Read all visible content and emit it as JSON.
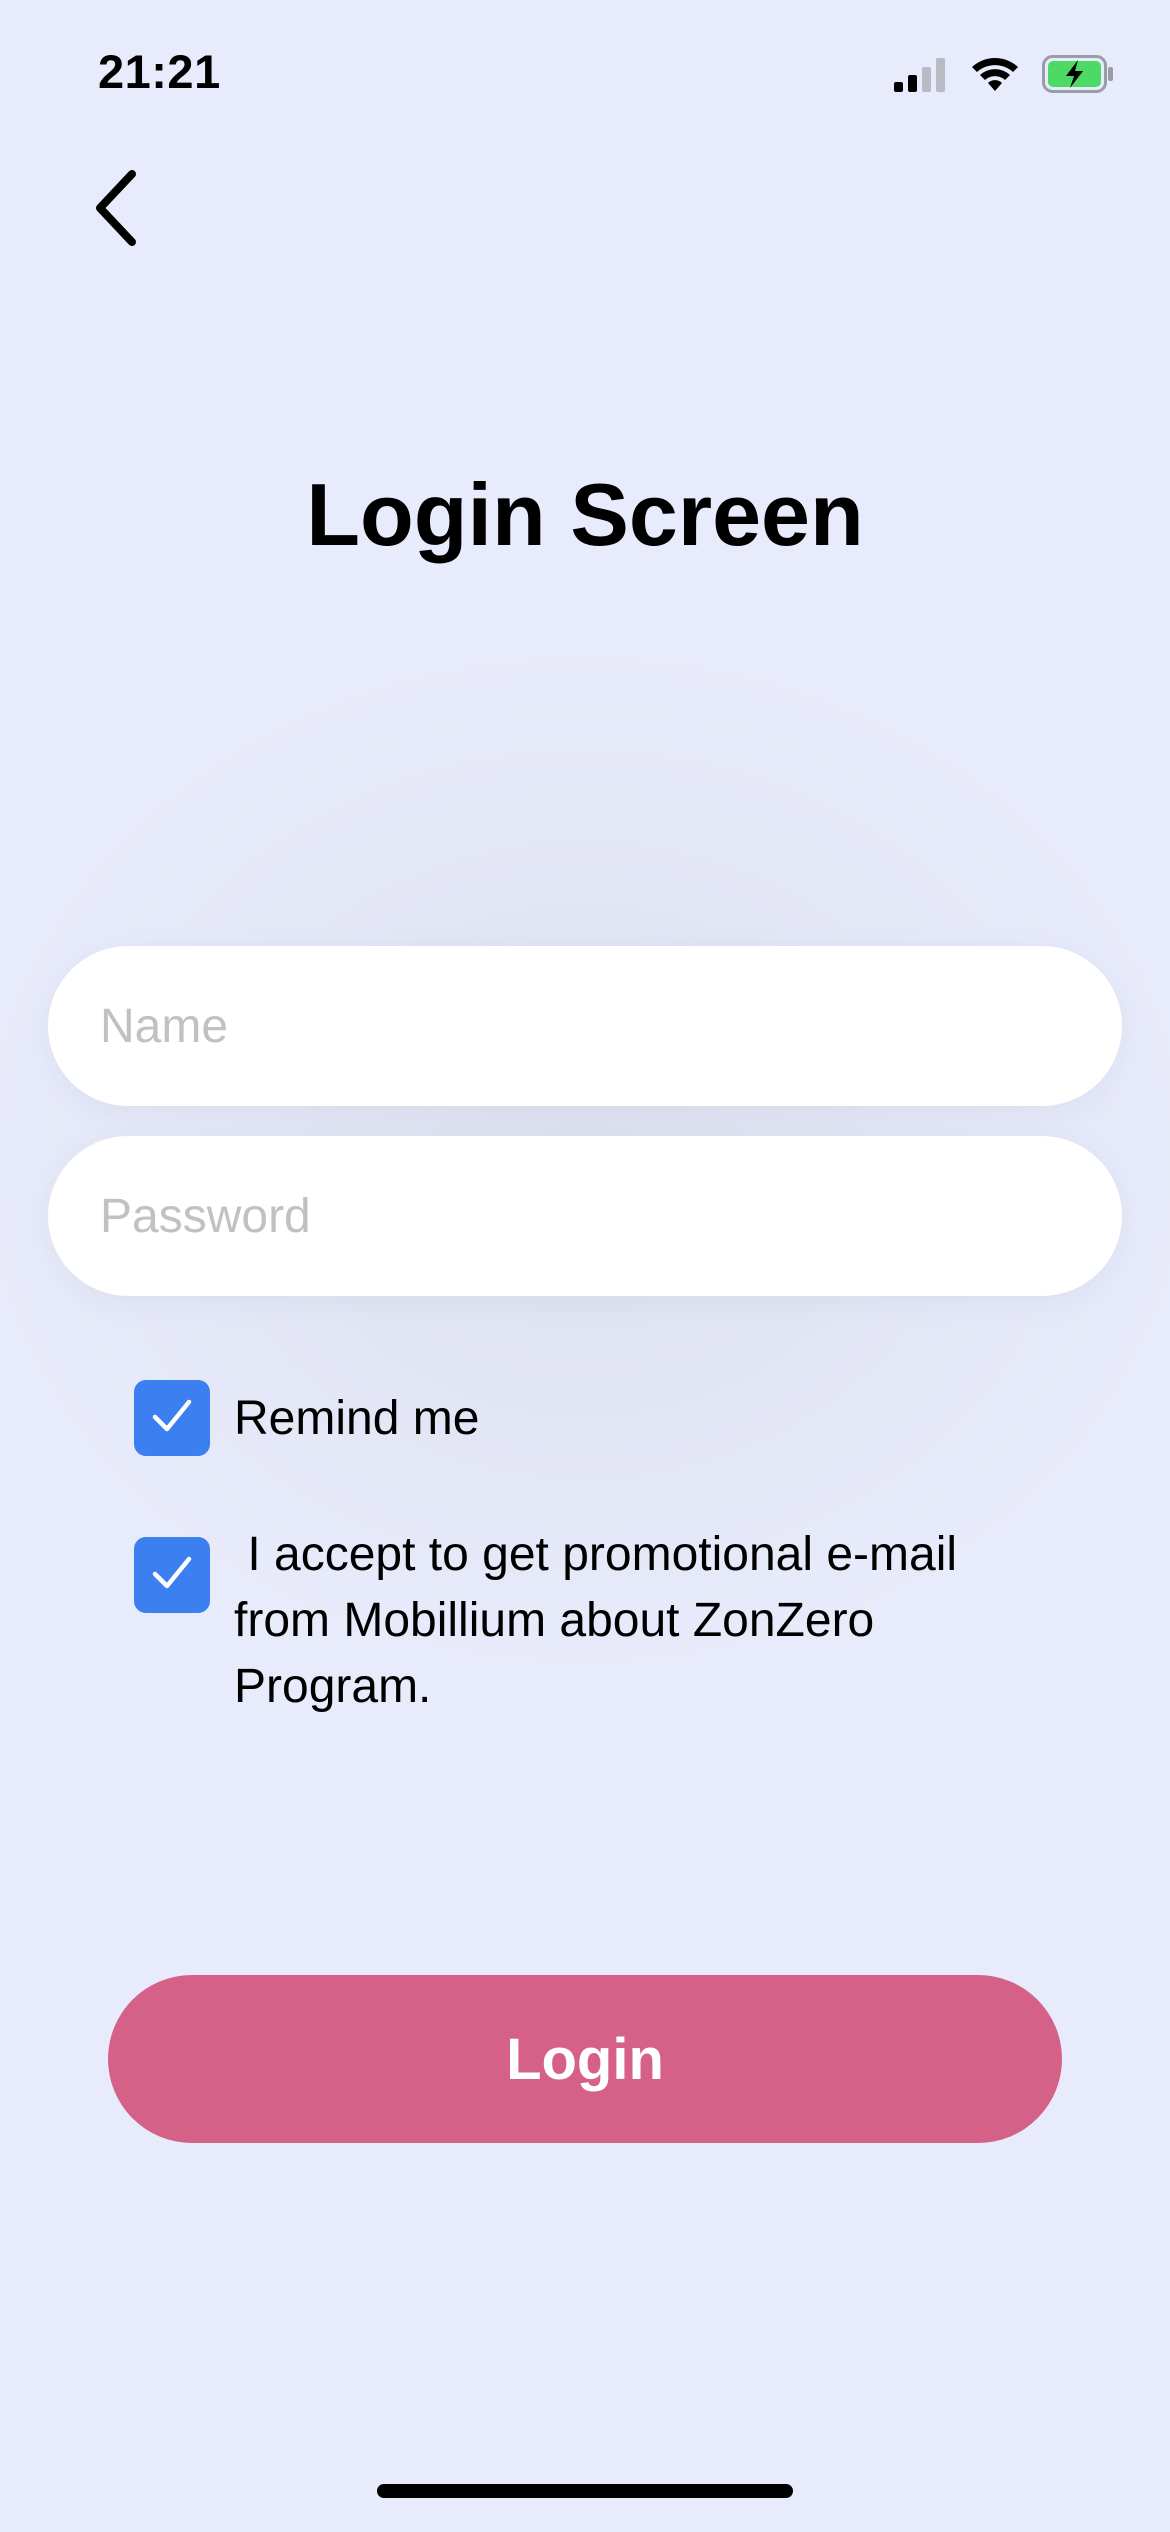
{
  "status_bar": {
    "time": "21:21",
    "icons": [
      "cellular-signal-icon",
      "wifi-icon",
      "battery-charging-icon"
    ]
  },
  "nav": {
    "back_icon": "chevron-left-icon"
  },
  "title": "Login Screen",
  "form": {
    "name_field": {
      "value": "",
      "placeholder": "Name"
    },
    "password_field": {
      "value": "",
      "placeholder": "Password"
    },
    "remind_me": {
      "label": "Remind me",
      "checked": true
    },
    "promo_consent": {
      "label": " I accept to get promotional e-mail from Mobillium about ZonZero Program.",
      "checked": true
    },
    "submit_label": "Login"
  },
  "colors": {
    "background": "#e8ebfb",
    "checkbox": "#3b7ff0",
    "login_button": "#d56088",
    "battery": "#4cd964"
  }
}
